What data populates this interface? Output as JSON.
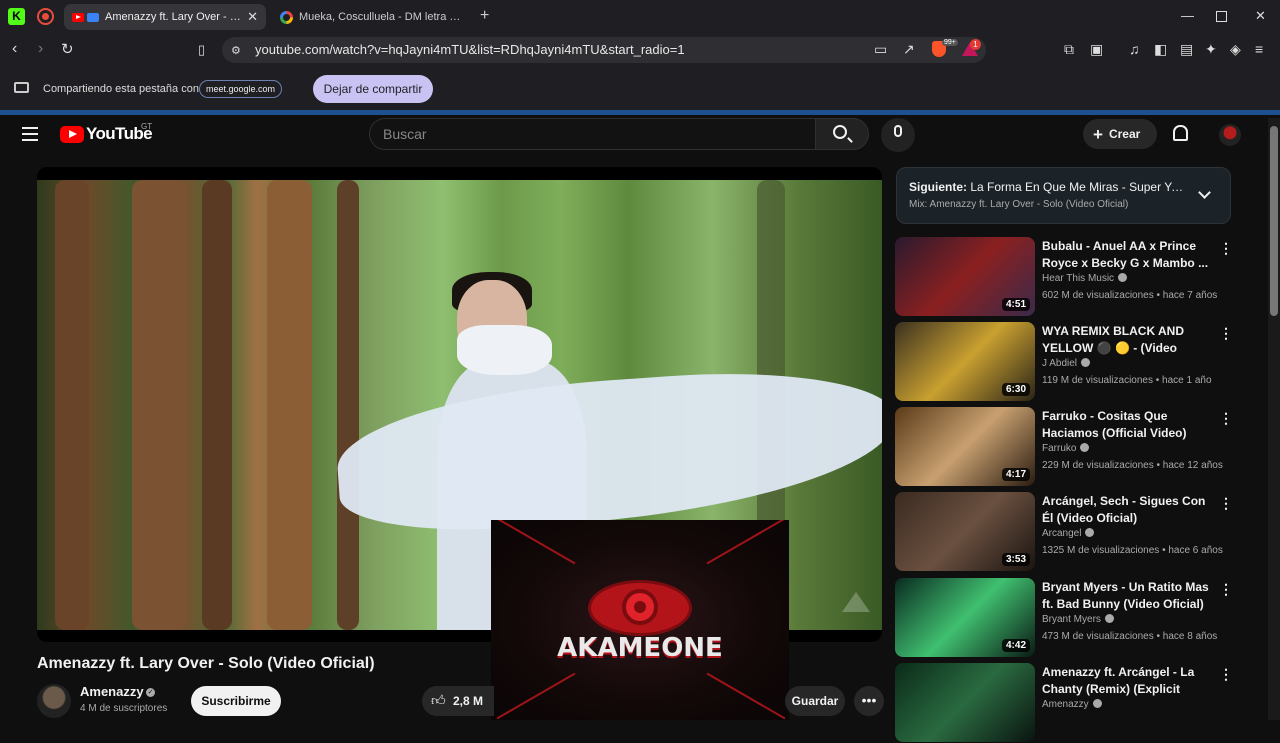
{
  "browser": {
    "tabs": [
      {
        "title": "Amenazzy ft. Lary Over - Solo (Video Oficial)",
        "active": true
      },
      {
        "title": "Mueka, Cosculluela - DM letra - Buscar con Google",
        "active": false
      }
    ],
    "url": "youtube.com/watch?v=hqJayni4mTU&list=RDhqJayni4mTU&start_radio=1",
    "ext_badge_brave": "99+",
    "ext_badge_alert": "1",
    "sharing_text": "Compartiendo esta pestaña con",
    "sharing_domain": "meet.google.com",
    "stop_sharing": "Dejar de compartir"
  },
  "yt": {
    "logo_text": "YouTube",
    "country": "GT",
    "search_placeholder": "Buscar",
    "create_label": "Crear"
  },
  "video": {
    "title": "Amenazzy ft. Lary Over - Solo (Video Oficial)",
    "channel": "Amenazzy",
    "subscribers": "4 M de suscriptores",
    "subscribe_label": "Suscribirme",
    "likes": "2,8 M",
    "save_label": "Guardar",
    "overlay_brand": "AKAMEONE"
  },
  "up_next": {
    "label": "Siguiente:",
    "title": "La Forma En Que Me Miras - Super Yei x ...",
    "mix": "Mix: Amenazzy ft. Lary Over - Solo (Video Oficial)"
  },
  "recommendations": [
    {
      "title": "Bubalu - Anuel AA x Prince Royce x Becky G x Mambo ...",
      "channel": "Hear This Music",
      "meta": "602 M de visualizaciones • hace 7 años",
      "duration": "4:51",
      "colors": [
        "#2a1a2e",
        "#8b2020",
        "#3a2a4a"
      ]
    },
    {
      "title": "WYA REMIX BLACK AND YELLOW ⚫ 🟡 - (Video Oficial...",
      "channel": "J Abdiel",
      "meta": "119 M de visualizaciones • hace 1 año",
      "duration": "6:30",
      "colors": [
        "#3a3020",
        "#c9a030",
        "#2a2418"
      ]
    },
    {
      "title": "Farruko - Cositas Que Haciamos (Official Video)",
      "channel": "Farruko",
      "meta": "229 M de visualizaciones • hace 12 años",
      "duration": "4:17",
      "colors": [
        "#5a3a18",
        "#c8a070",
        "#2a1c10"
      ]
    },
    {
      "title": "Arcángel, Sech - Sigues Con Él (Video Oficial)",
      "channel": "Arcangel",
      "meta": "1325 M de visualizaciones • hace 6 años",
      "duration": "3:53",
      "colors": [
        "#3a2a20",
        "#6a5040",
        "#1a1410"
      ]
    },
    {
      "title": "Bryant Myers - Un Ratito Mas ft. Bad Bunny (Video Oficial)",
      "channel": "Bryant Myers",
      "meta": "473 M de visualizaciones • hace 8 años",
      "duration": "4:42",
      "colors": [
        "#0a2a20",
        "#40c070",
        "#0a1a14"
      ]
    },
    {
      "title": "Amenazzy ft. Arcángel - La Chanty (Remix) (Explicit Audio)",
      "channel": "Amenazzy",
      "meta": "",
      "duration": "",
      "colors": [
        "#0a2a18",
        "#2a6a40",
        "#0a1410"
      ]
    }
  ]
}
